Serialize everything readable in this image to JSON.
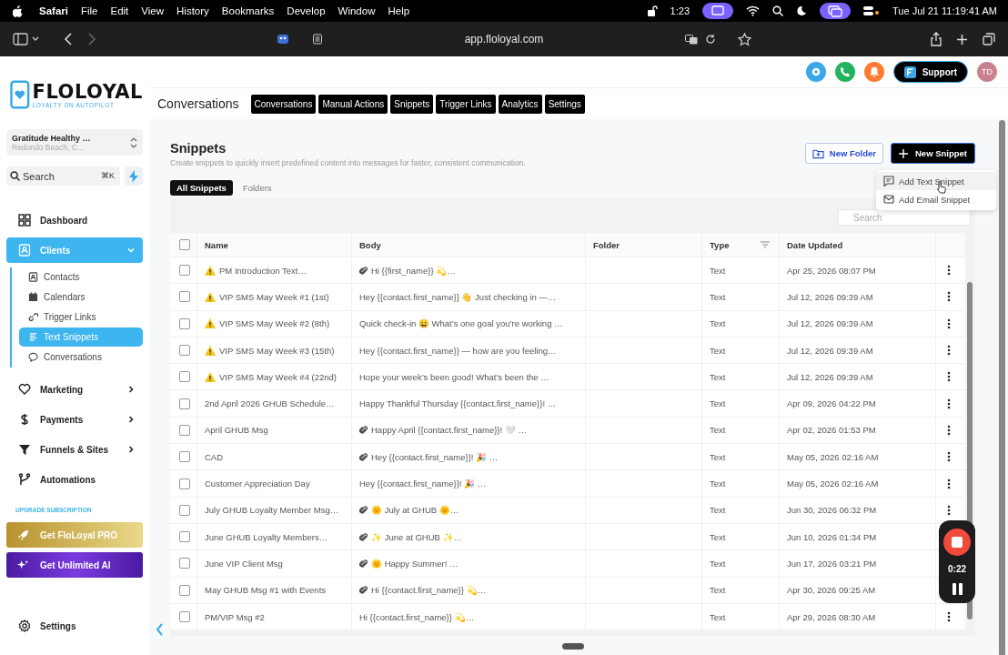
{
  "menubar": {
    "app": "Safari",
    "menus": [
      "File",
      "Edit",
      "View",
      "History",
      "Bookmarks",
      "Develop",
      "Window",
      "Help"
    ],
    "timer": "1:23",
    "datetime": "Tue Jul 21  11:19:41 AM"
  },
  "browser": {
    "url": "app.floloyal.com"
  },
  "logo": {
    "name": "FLOLOYAL",
    "tagline": "LOYALTY ON AUTOPILOT"
  },
  "header": {
    "title": "Conversations",
    "tabs": [
      "Conversations",
      "Manual Actions",
      "Snippets",
      "Trigger Links",
      "Analytics",
      "Settings"
    ],
    "support": "Support",
    "avatar": "TD"
  },
  "sidebar": {
    "account": {
      "name": "Gratitude Healthy …",
      "location": "Redondo Beach, C…"
    },
    "search": {
      "placeholder": "Search",
      "shortcut": "⌘K"
    },
    "nav": [
      {
        "label": "Dashboard",
        "selected": false
      },
      {
        "label": "Clients",
        "selected": true,
        "expanded": true,
        "children": [
          {
            "label": "Contacts",
            "selected": false
          },
          {
            "label": "Calendars",
            "selected": false
          },
          {
            "label": "Trigger Links",
            "selected": false
          },
          {
            "label": "Text Snippets",
            "selected": true
          },
          {
            "label": "Conversations",
            "selected": false
          }
        ]
      },
      {
        "label": "Marketing",
        "selected": false,
        "expanded": false
      },
      {
        "label": "Payments",
        "selected": false,
        "expanded": false
      },
      {
        "label": "Funnels & Sites",
        "selected": false,
        "expanded": false
      },
      {
        "label": "Automations",
        "selected": false
      }
    ],
    "upgrade_label": "UPGRADE SUBSCRIPTION",
    "promos": [
      {
        "label": "Get FloLoyal PRO",
        "kind": "pro"
      },
      {
        "label": "Get Unlimited AI",
        "kind": "ai"
      }
    ],
    "settings": "Settings"
  },
  "page": {
    "title": "Snippets",
    "subtitle": "Create snippets to quickly insert predefined content into messages for faster, consistent communication.",
    "tabs": [
      {
        "label": "All Snippets",
        "selected": true
      },
      {
        "label": "Folders",
        "selected": false
      }
    ],
    "new_folder": "New Folder",
    "new_snippet": "New Snippet",
    "menu": [
      {
        "label": "Add Text Snippet",
        "selected": true
      },
      {
        "label": "Add Email Snippet",
        "selected": false
      }
    ],
    "search": {
      "placeholder": "Search"
    }
  },
  "table": {
    "columns": [
      "Name",
      "Body",
      "Folder",
      "Type",
      "Date Updated"
    ],
    "all_checked": false,
    "rows": [
      {
        "checked": false,
        "warning": true,
        "name": "PM Introduction Text…",
        "attachment": true,
        "body": "Hi {{first_name}} 💫…",
        "type": "Text",
        "date": "Apr 25, 2026 08:07 PM"
      },
      {
        "checked": false,
        "warning": true,
        "name": "VIP SMS May Week #1 (1st)",
        "attachment": false,
        "body": "Hey {{contact.first_name}} 👋 Just checking in —…",
        "type": "Text",
        "date": "Jul 12, 2026 09:39 AM"
      },
      {
        "checked": false,
        "warning": true,
        "name": "VIP SMS May Week #2 (8th)",
        "attachment": false,
        "body": "Quick check-in 😀 What’s one goal you’re working …",
        "type": "Text",
        "date": "Jul 12, 2026 09:39 AM"
      },
      {
        "checked": false,
        "warning": true,
        "name": "VIP SMS May Week #3 (15th)",
        "attachment": false,
        "body": "Hey {{contact.first_name}} — how are you feeling…",
        "type": "Text",
        "date": "Jul 12, 2026 09:39 AM"
      },
      {
        "checked": false,
        "warning": true,
        "name": "VIP SMS May Week #4 (22nd)",
        "attachment": false,
        "body": "Hope your week’s been good! What’s been the …",
        "type": "Text",
        "date": "Jul 12, 2026 09:39 AM"
      },
      {
        "checked": false,
        "warning": false,
        "name": "2nd April 2026 GHUB Schedule…",
        "attachment": false,
        "body": "Happy Thankful Thursday {{contact.first_name}}! …",
        "type": "Text",
        "date": "Apr 09, 2026 04:22 PM"
      },
      {
        "checked": false,
        "warning": false,
        "name": "April GHUB Msg",
        "attachment": true,
        "body": "Happy April {{contact.first_name}}! 🤍 …",
        "type": "Text",
        "date": "Apr 02, 2026 01:53 PM"
      },
      {
        "checked": false,
        "warning": false,
        "name": "CAD",
        "attachment": true,
        "body": "Hey {{contact.first_name}}! 🎉 …",
        "type": "Text",
        "date": "May 05, 2026 02:16 AM"
      },
      {
        "checked": false,
        "warning": false,
        "name": "Customer Appreciation Day",
        "attachment": false,
        "body": "Hey {{contact.first_name}}! 🎉 …",
        "type": "Text",
        "date": "May 05, 2026 02:16 AM"
      },
      {
        "checked": false,
        "warning": false,
        "name": "July GHUB Loyalty Member Msg…",
        "attachment": true,
        "body": "🌞 July at GHUB 🌞…",
        "type": "Text",
        "date": "Jun 30, 2026 06:32 PM"
      },
      {
        "checked": false,
        "warning": false,
        "name": "June GHUB Loyalty Members…",
        "attachment": true,
        "body": "✨ June at GHUB ✨…",
        "type": "Text",
        "date": "Jun 10, 2026 01:34 PM"
      },
      {
        "checked": false,
        "warning": false,
        "name": "June VIP Client Msg",
        "attachment": true,
        "body": "🌞 Happy Summer! …",
        "type": "Text",
        "date": "Jun 17, 2026 03:21 PM"
      },
      {
        "checked": false,
        "warning": false,
        "name": "May GHUB Msg #1 with Events",
        "attachment": true,
        "body": "Hi {{contact.first_name}} 💫…",
        "type": "Text",
        "date": "Apr 30, 2026 09:25 AM"
      },
      {
        "checked": false,
        "warning": false,
        "name": "PM/VIP Msg #2",
        "attachment": false,
        "body": "Hi {{contact.first_name}} 💫…",
        "type": "Text",
        "date": "Apr 29, 2026 08:30 AM"
      }
    ]
  },
  "recorder": {
    "time": "0:22"
  }
}
